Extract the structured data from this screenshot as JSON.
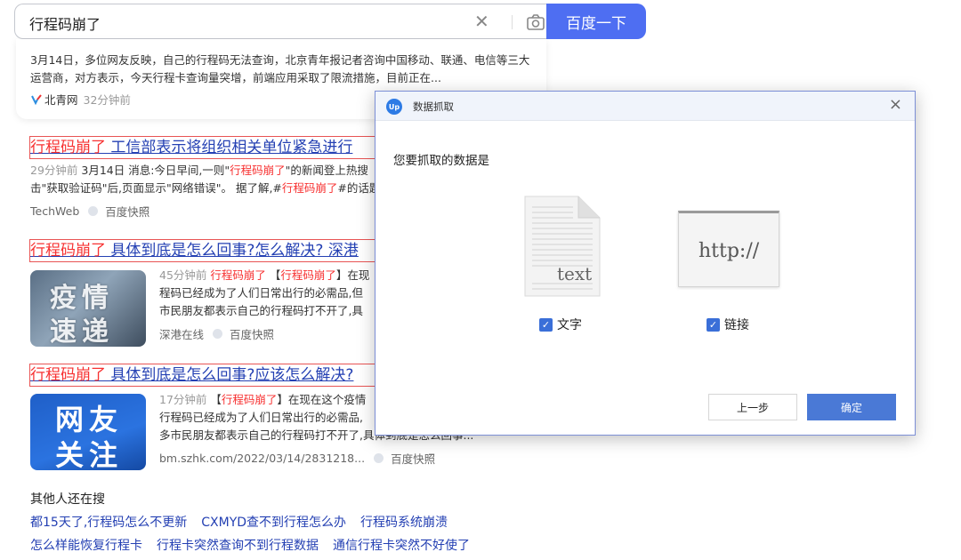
{
  "search": {
    "query": "行程码崩了",
    "button_label": "百度一下"
  },
  "top_card": {
    "abstract": "3月14日，多位网友反映，自己的行程码无法查询，北京青年报记者咨询中国移动、联通、电信等三大运营商，对方表示，今天行程卡查询量突增，前端应用采取了限流措施，目前正在...",
    "source": "北青网",
    "time": "32分钟前"
  },
  "results": [
    {
      "title_hl": "行程码崩了",
      "title_rest": " 工信部表示将组织相关单位紧急进行",
      "abstract_time": "29分钟前",
      "abstract_pre": " 3月14日 消息:今日早间,一则\"",
      "abstract_kw": "行程码崩了",
      "abstract_post": "\"的新闻登上热搜",
      "abstract_line2_pre": "击\"获取验证码\"后,页面显示\"网络错误\"。 据了解,#",
      "abstract_line2_kw": "行程码崩了",
      "abstract_line2_post": "#的话题",
      "source": "TechWeb",
      "snapshot": "百度快照"
    },
    {
      "title_hl": "行程码崩了",
      "title_rest": " 具体到底是怎么回事?怎么解决? 深港",
      "thumb_text_1": "疫情",
      "thumb_text_2": "速递",
      "abstract_time": "45分钟前",
      "abstract_kw": "行程码崩了",
      "abstract_bracket_kw": "行程码崩了",
      "abstract_tail": "在现",
      "line2": "程码已经成为了人们日常出行的必需品,但",
      "line3": "市民朋友都表示自己的行程码打不开了,具",
      "source": "深港在线",
      "snapshot": "百度快照"
    },
    {
      "title_hl": "行程码崩了",
      "title_rest": " 具体到底是怎么回事?应该怎么解决?",
      "thumb_text_1": "网友",
      "thumb_text_2": "关注",
      "abstract_time": "17分钟前",
      "abstract_bracket_kw": "行程码崩了",
      "abstract_tail": "在现在这个疫情",
      "line2": "行程码已经成为了人们日常出行的必需品,",
      "line3": "多市民朋友都表示自己的行程码打不开了,具体到底是怎么回事...",
      "source": "bm.szhk.com/2022/03/14/2831218...",
      "snapshot": "百度快照"
    }
  ],
  "related": {
    "heading": "其他人还在搜",
    "row1": [
      "都15天了,行程码怎么不更新",
      "CXMYD查不到行程怎么办",
      "行程码系统崩溃"
    ],
    "row2": [
      "怎么样能恢复行程卡",
      "行程卡突然查询不到行程数据",
      "通信行程卡突然不好使了"
    ]
  },
  "dialog": {
    "logo_text": "Up",
    "title": "数据抓取",
    "prompt": "您要抓取的数据是",
    "doc_icon_text": "text",
    "http_icon_text": "http://",
    "option_text_label": "文字",
    "option_link_label": "链接",
    "option_text_checked": true,
    "option_link_checked": true,
    "prev_button": "上一步",
    "ok_button": "确定",
    "close_glyph": "×"
  },
  "colors": {
    "accent": "#4e6ef2",
    "link": "#2440b3",
    "highlight": "#f73131",
    "checkbox": "#3a6fd8",
    "ok_button": "#4a79d6"
  }
}
